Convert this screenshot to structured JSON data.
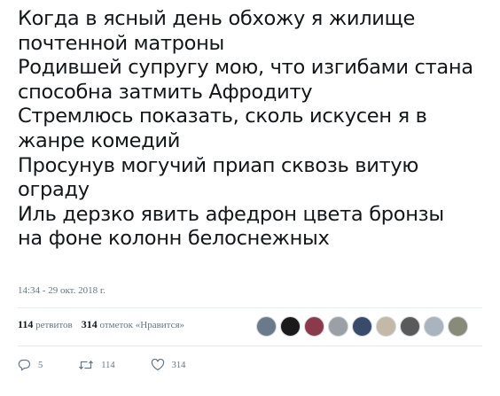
{
  "tweet": {
    "lines": [
      "Когда в ясный день обхожу я жилище",
      "почтенной матроны",
      "Родившей супругу мою, что изгибами стана",
      "способна затмить Афродиту",
      "Стремлюсь показать, сколь искусен я в",
      "жанре комедий",
      "Просунув могучий приап сквозь витую",
      "ограду",
      "Иль дерзко явить афедрон цвета бронзы",
      "на фоне колонн белоснежных"
    ],
    "timestamp": "14:34 - 29 окт. 2018 г."
  },
  "stats": {
    "retweets_count": "114",
    "retweets_label": "ретвитов",
    "likes_count": "314",
    "likes_label": "отметок «Нравится»"
  },
  "avatars": [
    {
      "color": "#6b7a8a"
    },
    {
      "color": "#1a1a1a"
    },
    {
      "color": "#8a3a4a"
    },
    {
      "color": "#9aa0a6"
    },
    {
      "color": "#3a4a6a"
    },
    {
      "color": "#c4b9a8"
    },
    {
      "color": "#5a5a5a"
    },
    {
      "color": "#aab4be"
    },
    {
      "color": "#8a8a7a"
    }
  ],
  "actions": {
    "reply_count": "5",
    "retweet_count": "114",
    "like_count": "314"
  },
  "icons": {
    "reply": "reply-icon",
    "retweet": "retweet-icon",
    "like": "heart-icon"
  }
}
